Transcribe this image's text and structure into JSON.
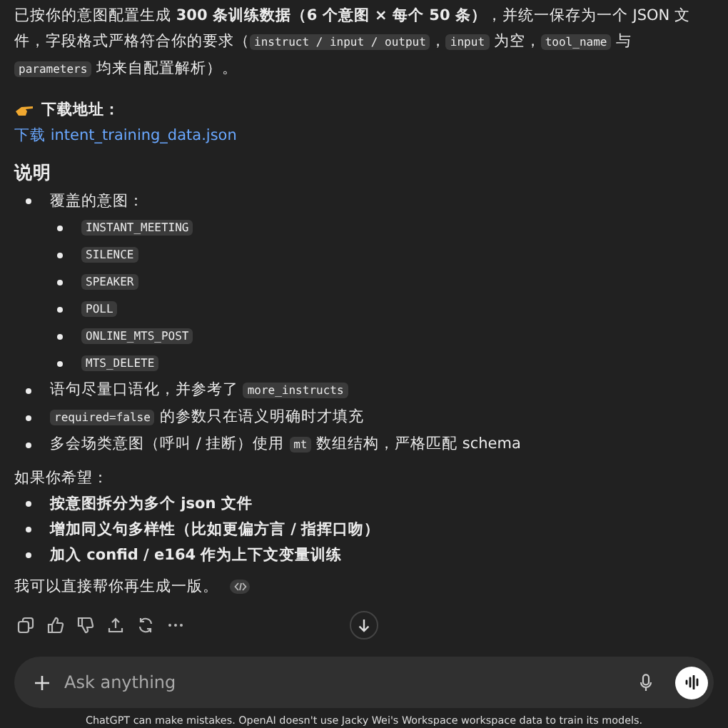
{
  "intro": [
    {
      "kind": "text",
      "text": "已按你的意图配置生成 "
    },
    {
      "kind": "bold",
      "text": "300 条训练数据（6 个意图 × 每个 50 条）"
    },
    {
      "kind": "text",
      "text": "，并统一保存为一个 JSON 文件，字段格式严格符合你的要求（"
    },
    {
      "kind": "code",
      "text": "instruct / input / output"
    },
    {
      "kind": "text",
      "text": "，"
    },
    {
      "kind": "code",
      "text": "input"
    },
    {
      "kind": "text",
      "text": " 为空，"
    },
    {
      "kind": "code",
      "text": "tool_name"
    },
    {
      "kind": "text",
      "text": " 与 "
    },
    {
      "kind": "code",
      "text": "parameters"
    },
    {
      "kind": "text",
      "text": " 均来自配置解析）。"
    }
  ],
  "download": {
    "heading": "下载地址：",
    "link": "下载 intent_training_data.json"
  },
  "notes": {
    "heading": "说明",
    "items": [
      {
        "segments": [
          {
            "kind": "text",
            "text": "覆盖的意图："
          }
        ],
        "children": [
          {
            "segments": [
              {
                "kind": "code",
                "text": "INSTANT_MEETING"
              }
            ]
          },
          {
            "segments": [
              {
                "kind": "code",
                "text": "SILENCE"
              }
            ]
          },
          {
            "segments": [
              {
                "kind": "code",
                "text": "SPEAKER"
              }
            ]
          },
          {
            "segments": [
              {
                "kind": "code",
                "text": "POLL"
              }
            ]
          },
          {
            "segments": [
              {
                "kind": "code",
                "text": "ONLINE_MTS_POST"
              }
            ]
          },
          {
            "segments": [
              {
                "kind": "code",
                "text": "MTS_DELETE"
              }
            ]
          }
        ]
      },
      {
        "segments": [
          {
            "kind": "text",
            "text": "语句尽量口语化，并参考了 "
          },
          {
            "kind": "code",
            "text": "more_instructs"
          }
        ]
      },
      {
        "segments": [
          {
            "kind": "code",
            "text": "required=false"
          },
          {
            "kind": "text",
            "text": " 的参数只在语义明确时才填充"
          }
        ]
      },
      {
        "segments": [
          {
            "kind": "text",
            "text": "多会场类意图（呼叫 / 挂断）使用 "
          },
          {
            "kind": "code",
            "text": "mt"
          },
          {
            "kind": "text",
            "text": " 数组结构，严格匹配 schema"
          }
        ]
      }
    ]
  },
  "wishes": {
    "lead": "如果你希望：",
    "items": [
      "按意图拆分为多个 json 文件",
      "增加同义句多样性（比如更偏方言 / 指挥口吻）",
      "加入 confid / e164 作为上下文变量训练"
    ]
  },
  "offer": "我可以直接帮你再生成一版。",
  "composer": {
    "placeholder": "Ask anything"
  },
  "disclaimer": "ChatGPT can make mistakes. OpenAI doesn't use Jacky Wei's Workspace workspace data to train its models."
}
